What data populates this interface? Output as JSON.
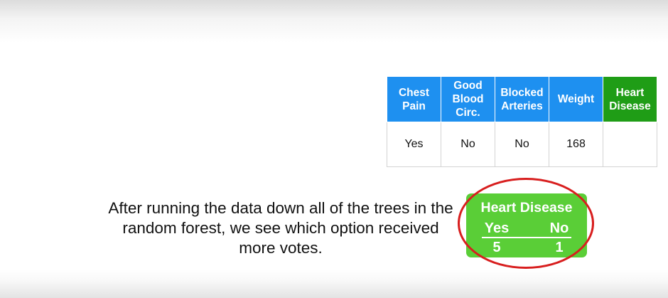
{
  "table": {
    "headers": [
      "Chest Pain",
      "Good Blood Circ.",
      "Blocked Arteries",
      "Weight",
      "Heart Disease"
    ],
    "row": [
      "Yes",
      "No",
      "No",
      "168",
      ""
    ]
  },
  "caption": "After running the data down all of the trees in the random forest, we see which option received more votes.",
  "votes": {
    "title": "Heart Disease",
    "yes_label": "Yes",
    "no_label": "No",
    "yes_count": "5",
    "no_count": "1"
  },
  "colors": {
    "header_blue": "#1e90f0",
    "header_green": "#1f9d16",
    "vote_box_green": "#5ace37",
    "highlight_red": "#d81e1e"
  }
}
